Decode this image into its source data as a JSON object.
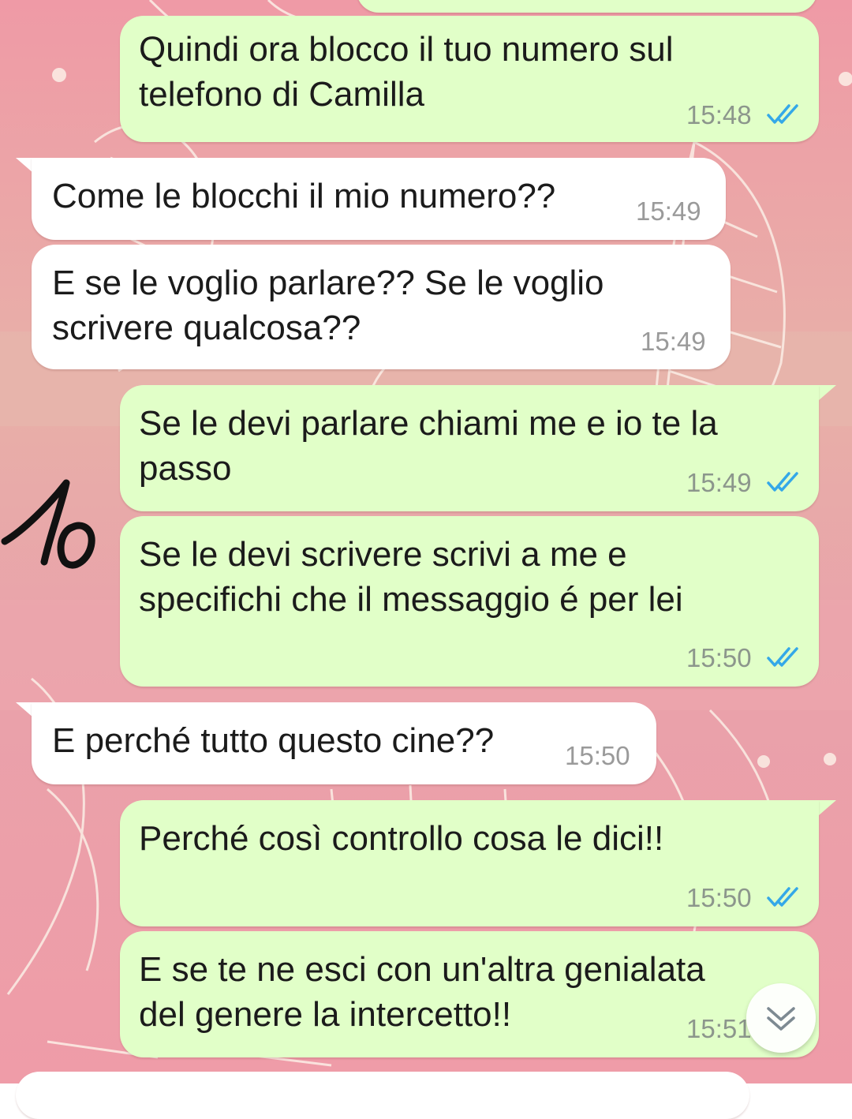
{
  "colors": {
    "outgoing_bubble": "#e1ffc8",
    "incoming_bubble": "#ffffff",
    "read_ticks": "#34a8e8",
    "wallpaper": "#ef9aa6"
  },
  "annotation": {
    "handwritten_text": "10"
  },
  "messages": [
    {
      "direction": "out",
      "text": "Quindi ora blocco il tuo numero sul\ntelefono di Camilla",
      "time": "15:48",
      "status": "read"
    },
    {
      "direction": "in",
      "text": "Come le blocchi il mio numero??",
      "time": "15:49"
    },
    {
      "direction": "in",
      "text": "E se le voglio parlare?? Se le voglio\nscrivere qualcosa??",
      "time": "15:49"
    },
    {
      "direction": "out",
      "text": "Se le devi parlare chiami me e io te la\npasso",
      "time": "15:49",
      "status": "read"
    },
    {
      "direction": "out",
      "text": "Se le devi scrivere scrivi a me e\nspecifichi che il messaggio é per lei",
      "time": "15:50",
      "status": "read"
    },
    {
      "direction": "in",
      "text": "E perché tutto questo cine??",
      "time": "15:50"
    },
    {
      "direction": "out",
      "text": "Perché così controllo cosa le dici!!",
      "time": "15:50",
      "status": "read"
    },
    {
      "direction": "out",
      "text": "E se te ne esci con un'altra genialata\ndel genere la intercetto!!",
      "time": "15:51",
      "status": "read"
    }
  ],
  "scroll_button": {
    "icon": "double-chevron-down-icon"
  }
}
